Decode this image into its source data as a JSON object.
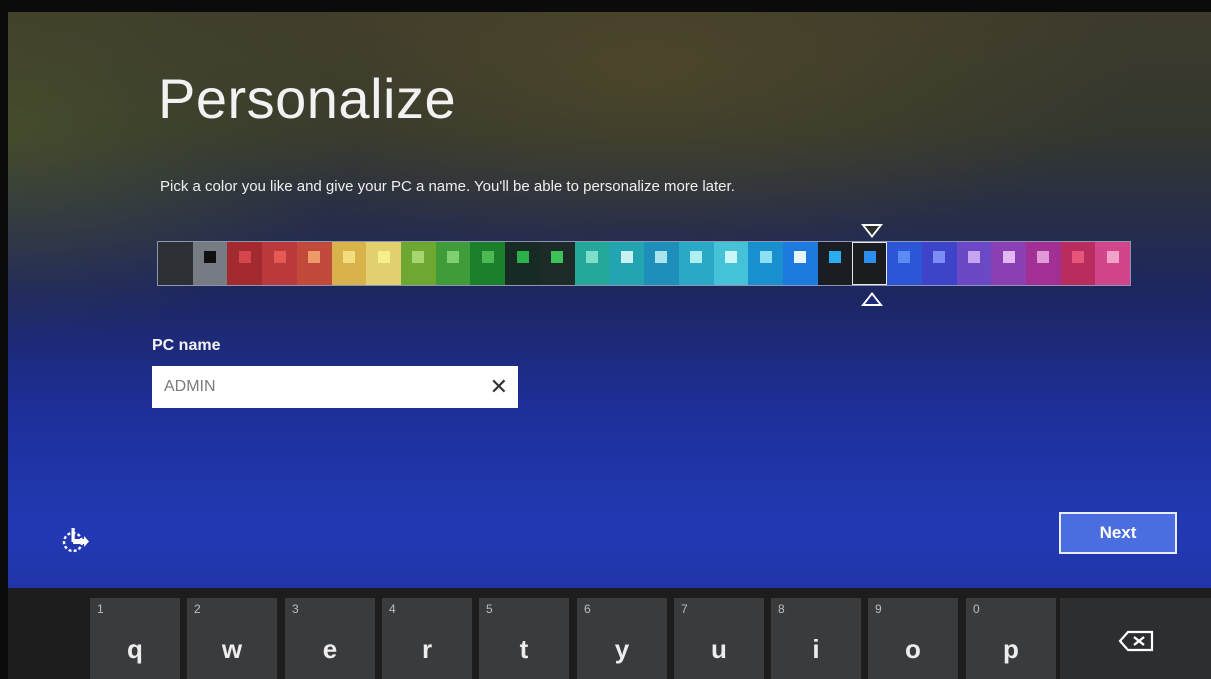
{
  "page": {
    "title": "Personalize",
    "subtitle": "Pick a color you like and give your PC a name. You'll be able to personalize more later."
  },
  "color_picker": {
    "selected_index": 20,
    "swatches": [
      {
        "bg": "#2d3035",
        "accent": "#2d3035"
      },
      {
        "bg": "#767b84",
        "accent": "#101010"
      },
      {
        "bg": "#a32a2e",
        "accent": "#d7454c"
      },
      {
        "bg": "#b9393c",
        "accent": "#e65a54"
      },
      {
        "bg": "#c24a3a",
        "accent": "#f09a6a"
      },
      {
        "bg": "#d8b24a",
        "accent": "#f4dd7c"
      },
      {
        "bg": "#e0d070",
        "accent": "#f6f08c"
      },
      {
        "bg": "#6ea830",
        "accent": "#a5d670"
      },
      {
        "bg": "#3f9c38",
        "accent": "#7fd06f"
      },
      {
        "bg": "#1c7f2c",
        "accent": "#4cba50"
      },
      {
        "bg": "#182a24",
        "accent": "#2bb14b"
      },
      {
        "bg": "#1c2a28",
        "accent": "#3cc255"
      },
      {
        "bg": "#25a89a",
        "accent": "#7ee0c8"
      },
      {
        "bg": "#22a5b0",
        "accent": "#c8f2f2"
      },
      {
        "bg": "#1d8fba",
        "accent": "#a8e4ec"
      },
      {
        "bg": "#2aa9c6",
        "accent": "#aef0f0"
      },
      {
        "bg": "#46c2d8",
        "accent": "#c8f8f8"
      },
      {
        "bg": "#1a8fcf",
        "accent": "#8de0f4"
      },
      {
        "bg": "#1d7be0",
        "accent": "#e8f4ff"
      },
      {
        "bg": "#1a1d22",
        "accent": "#2aaef0"
      },
      {
        "bg": "#1a1c20",
        "accent": "#2c8ef0"
      },
      {
        "bg": "#2c56d6",
        "accent": "#5a8cf2"
      },
      {
        "bg": "#3d44c9",
        "accent": "#7b8cf2"
      },
      {
        "bg": "#6a48c6",
        "accent": "#c6a4f0"
      },
      {
        "bg": "#8a3fb2",
        "accent": "#e2b8f4"
      },
      {
        "bg": "#a23094",
        "accent": "#e09ad8"
      },
      {
        "bg": "#b92d5e",
        "accent": "#e8557a"
      },
      {
        "bg": "#d1458a",
        "accent": "#f2a2c8"
      }
    ]
  },
  "pc_name": {
    "label": "PC name",
    "value": "ADMIN",
    "clear_icon": "close-icon"
  },
  "ease_of_access": {
    "icon": "ease-of-access-icon"
  },
  "next_button": {
    "label": "Next",
    "color": "#4a6de0"
  },
  "keyboard": {
    "keys": [
      {
        "num": "1",
        "letter": "q"
      },
      {
        "num": "2",
        "letter": "w"
      },
      {
        "num": "3",
        "letter": "e"
      },
      {
        "num": "4",
        "letter": "r"
      },
      {
        "num": "5",
        "letter": "t"
      },
      {
        "num": "6",
        "letter": "y"
      },
      {
        "num": "7",
        "letter": "u"
      },
      {
        "num": "8",
        "letter": "i"
      },
      {
        "num": "9",
        "letter": "o"
      },
      {
        "num": "0",
        "letter": "p"
      }
    ],
    "backspace_icon": "backspace-icon"
  }
}
